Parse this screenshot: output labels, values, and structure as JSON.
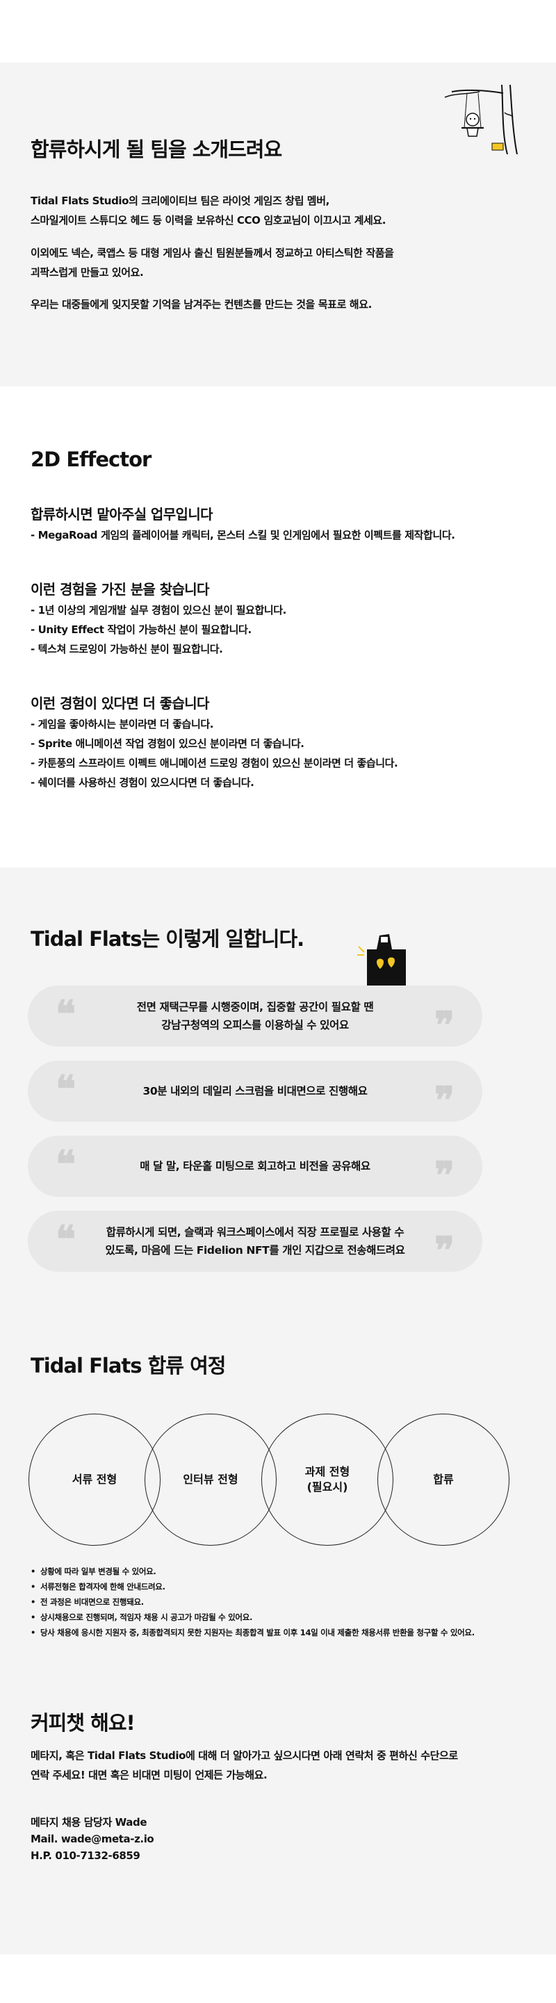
{
  "team": {
    "title": "합류하시게 될 팀을 소개드려요",
    "paragraphs": [
      "Tidal Flats Studio의 크리에이티브 팀은 라이엇 게임즈 창립 멤버,\n스마일게이트 스튜디오 헤드 등 이력을 보유하신 CCO 임호교님이 이끄시고 계세요.",
      "이외에도 넥슨, 쿡앱스 등 대형 게임사 출신 팀원분들께서 정교하고 아티스틱한 작품을\n괴팍스럽게 만들고 있어요.",
      "우리는 대중들에게 잊지못할 기억을 남겨주는 컨텐츠를 만드는 것을 목표로 해요."
    ]
  },
  "role": {
    "title": "2D Effector",
    "duties_heading": "합류하시면 맡아주실 업무입니다",
    "duties": [
      "- MegaRoad 게임의 플레이어블 캐릭터, 몬스터 스킬 및 인게임에서 필요한 이펙트를 제작합니다."
    ],
    "requirements_heading": "이런 경험을 가진 분을 찾습니다",
    "requirements": [
      "- 1년 이상의 게임개발 실무 경험이 있으신 분이 필요합니다.",
      "- Unity Effect 작업이 가능하신 분이 필요합니다.",
      "- 텍스쳐 드로잉이 가능하신 분이 필요합니다."
    ],
    "preferred_heading": "이런 경험이 있다면 더 좋습니다",
    "preferred": [
      "- 게임을 좋아하시는 분이라면 더 좋습니다.",
      "- Sprite 애니메이션 작업 경험이 있으신 분이라면 더 좋습니다.",
      "- 카툰풍의 스프라이트 이펙트 애니메이션 드로잉 경험이 있으신 분이라면 더 좋습니다.",
      "- 쉐이더를 사용하신 경험이 있으시다면 더 좋습니다."
    ]
  },
  "work": {
    "title": "Tidal Flats는 이렇게 일합니다.",
    "cards": [
      "전면 재택근무를 시행중이며, 집중할 공간이 필요할 땐\n강남구청역의 오피스를 이용하실 수 있어요",
      "30분 내외의 데일리 스크럼을 비대면으로 진행해요",
      "매 달 말, 타운홀 미팅으로 회고하고 비전을 공유해요",
      "합류하시게 되면, 슬랙과 워크스페이스에서 직장 프로필로 사용할 수\n있도록, 마음에 드는 Fidelion NFT를 개인 지갑으로 전송해드려요"
    ],
    "quote_open": "❝",
    "quote_close": "❞"
  },
  "journey": {
    "title": "Tidal Flats 합류 여정",
    "steps": [
      "서류 전형",
      "인터뷰 전형",
      "과제 전형\n(필요시)",
      "합류"
    ],
    "notes": [
      "상황에 따라 일부 변경될 수 있어요.",
      "서류전형은 합격자에 한해 안내드려요.",
      "전 과정은 비대면으로 진행돼요.",
      "상시채용으로 진행되며, 적임자 채용 시 공고가 마감될 수 있어요.",
      "당사 채용에 응시한 지원자 중, 최종합격되지 못한 지원자는 최종합격 발표 이후 14일 이내 제출한 채용서류 반환을 청구할 수 있어요."
    ]
  },
  "contact": {
    "title": "커피챗 해요!",
    "body": "메타지, 혹은 Tidal Flats Studio에 대해 더 알아가고 싶으시다면 아래 연락처 중 편하신 수단으로\n연락 주세요! 대면 혹은 비대면 미팅이 언제든 가능해요.",
    "name": "메타지 채용 담당자 Wade",
    "mail": "Mail. wade@meta-z.io",
    "phone": "H.P. 010-7132-6859"
  }
}
